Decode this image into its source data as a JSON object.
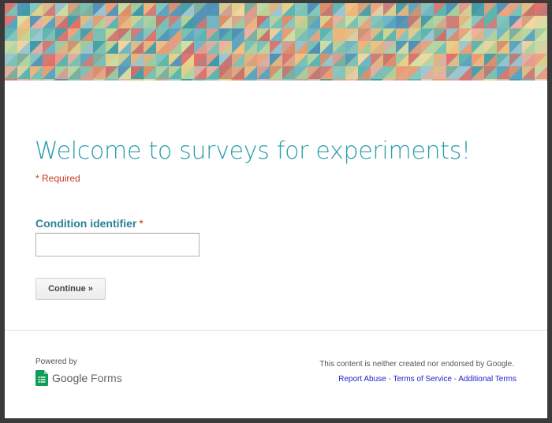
{
  "form": {
    "title": "Welcome to surveys for experiments!",
    "required_note": "* Required",
    "question": {
      "label": "Condition identifier",
      "required_marker": "*",
      "value": ""
    },
    "continue_label": "Continue »"
  },
  "footer": {
    "powered_by": "Powered by",
    "brand_google": "Google",
    "brand_forms": "Forms",
    "disclaimer": "This content is neither created nor endorsed by Google.",
    "separator": " - ",
    "links": {
      "report_abuse": "Report Abuse",
      "terms_of_service": "Terms of Service",
      "additional_terms": "Additional Terms"
    }
  },
  "colors": {
    "title": "#2a9dab",
    "required": "#c43b1d",
    "question_label": "#2a7f9b",
    "link": "#2222cc",
    "forms_icon": "#0f9d58"
  },
  "icons": {
    "forms_logo": "google-forms-icon"
  }
}
